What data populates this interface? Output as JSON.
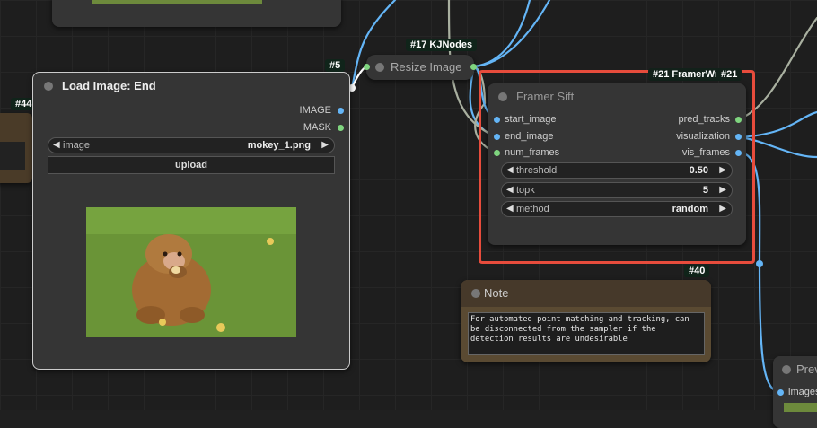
{
  "nodes": {
    "partial_left": {
      "badge": "#44"
    },
    "load_image": {
      "badge": "#5",
      "title": "Load Image: End",
      "outputs": [
        "IMAGE",
        "MASK"
      ],
      "image_widget": {
        "label": "image",
        "value": "mokey_1.png"
      },
      "upload_label": "upload",
      "preview_description": "monkey"
    },
    "resize_image": {
      "badge": "#17 KJNodes",
      "title": "Resize Image"
    },
    "framer_sift": {
      "badge": "#21 FramerWr",
      "badge2": "#21",
      "title": "Framer Sift",
      "inputs": [
        "start_image",
        "end_image",
        "num_frames"
      ],
      "outputs": [
        "pred_tracks",
        "visualization",
        "vis_frames"
      ],
      "widgets": [
        {
          "label": "threshold",
          "value": "0.50"
        },
        {
          "label": "topk",
          "value": "5"
        },
        {
          "label": "method",
          "value": "random"
        }
      ]
    },
    "note": {
      "badge": "#40",
      "title": "Note",
      "text": "For automated point matching and tracking, can be disconnected from the sampler if the detection results are undesirable"
    },
    "preview": {
      "title": "Prev",
      "input": "images"
    }
  },
  "colors": {
    "highlight": "#e74c3c",
    "link_blue": "#64b5f6",
    "link_gray": "#a9b0a0",
    "note_bg": "#4d3f2a"
  }
}
